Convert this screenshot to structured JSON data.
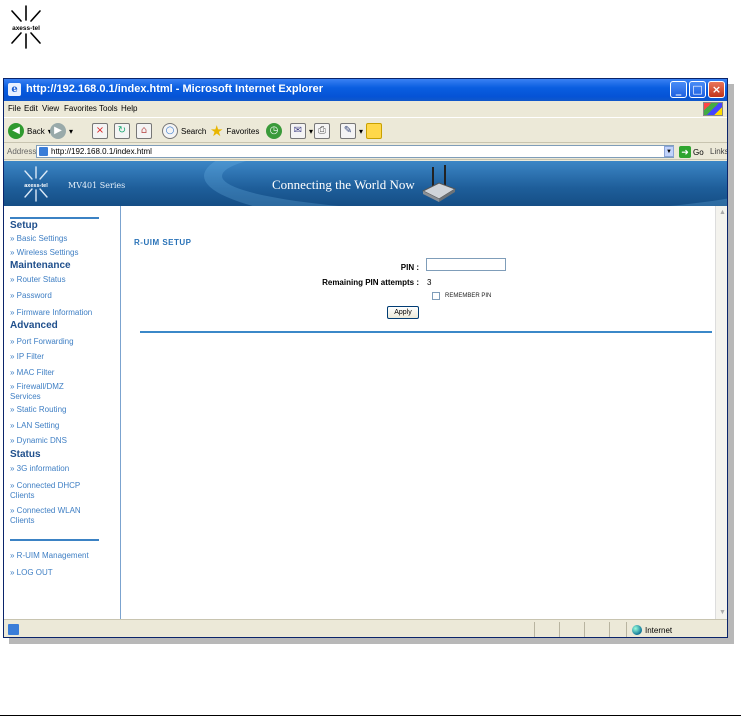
{
  "doc_logo": {
    "text": "axess-tel"
  },
  "window": {
    "title": "http://192.168.0.1/index.html - Microsoft Internet Explorer",
    "controls": {
      "min": "_",
      "max": "□",
      "close": "×"
    }
  },
  "menu": [
    "File",
    "Edit",
    "View",
    "Favorites",
    "Tools",
    "Help"
  ],
  "toolbar": {
    "back": "Back",
    "search": "Search",
    "favorites": "Favorites"
  },
  "address": {
    "label": "Address",
    "url": "http://192.168.0.1/index.html",
    "go": "Go",
    "links": "Links"
  },
  "banner": {
    "logo_text": "axess-tel",
    "series": "MV401 Series",
    "slogan": "Connecting the World Now"
  },
  "sidebar": {
    "setup": {
      "title": "Setup",
      "items": [
        "» Basic Settings",
        "» Wireless Settings"
      ]
    },
    "maintenance": {
      "title": "Maintenance",
      "items": [
        "» Router Status",
        "» Password",
        "» Firmware Information"
      ]
    },
    "advanced": {
      "title": "Advanced",
      "items": [
        "» Port Forwarding",
        "» IP Filter",
        "» MAC Filter",
        "» Firewall/DMZ Services",
        "» Static Routing",
        "» LAN Setting",
        "» Dynamic DNS"
      ]
    },
    "status": {
      "title": "Status",
      "items": [
        "» 3G information",
        "» Connected DHCP Clients",
        "» Connected WLAN Clients"
      ]
    },
    "extra": [
      "» R-UIM Management",
      "» LOG OUT"
    ]
  },
  "main": {
    "title": "R-UIM SETUP",
    "pin_label": "PIN :",
    "pin_value": "",
    "attempts_label": "Remaining PIN attempts :",
    "attempts_value": "3",
    "remember_label": "REMEMBER PIN",
    "remember_checked": false,
    "apply": "Apply"
  },
  "status_bar": {
    "zone": "Internet"
  }
}
